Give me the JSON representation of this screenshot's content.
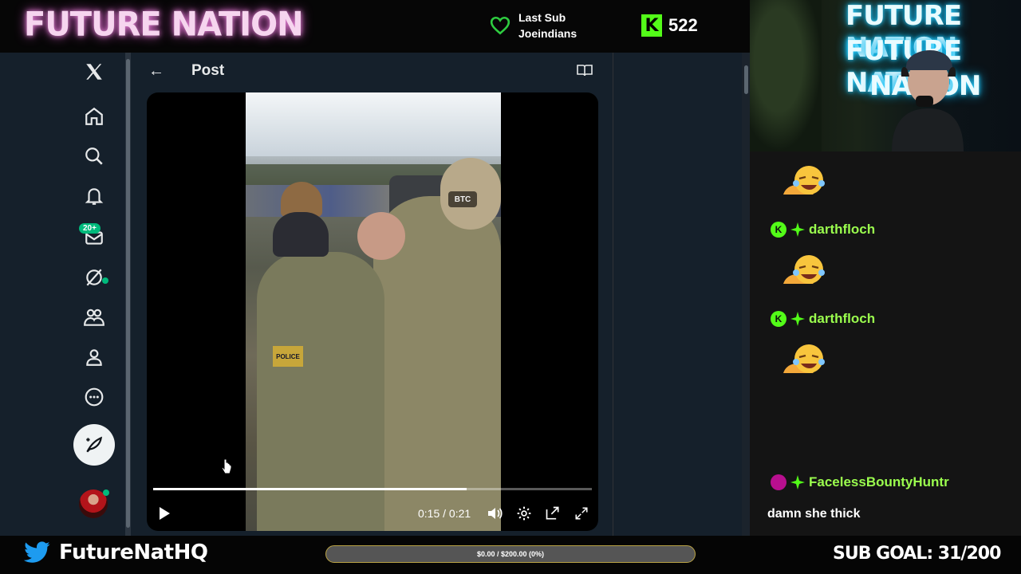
{
  "stream": {
    "brand": "FUTURE NATION",
    "last_sub_label": "Last Sub",
    "last_sub_name": "Joeindians",
    "kick_logo": "K",
    "kick_count": "522",
    "colors": {
      "kick_green": "#53fc18",
      "heart_green": "#2ecc40",
      "twitter_bg": "#15202b",
      "chat_bg": "#141414"
    }
  },
  "twitter": {
    "nav": [
      {
        "name": "x-logo-icon"
      },
      {
        "name": "home-icon"
      },
      {
        "name": "search-icon"
      },
      {
        "name": "notifications-bell-icon"
      },
      {
        "name": "messages-icon",
        "badge": "20+"
      },
      {
        "name": "grok-icon"
      },
      {
        "name": "communities-icon"
      },
      {
        "name": "profile-icon"
      },
      {
        "name": "more-icon"
      }
    ],
    "post_header": {
      "title": "Post",
      "back": "←"
    },
    "video": {
      "time": "0:15 / 0:21",
      "progress": 0.714,
      "patch_left": "POLICE",
      "patch_right": "BTC"
    }
  },
  "cam": {
    "neon_lines": [
      "FUTURE NATION",
      "FUTURE NATION",
      "NATION"
    ]
  },
  "chat": {
    "messages": [
      {
        "type": "emote"
      },
      {
        "user": "darthfloch",
        "badge": "kick",
        "type": "emote"
      },
      {
        "user": "darthfloch",
        "badge": "kick",
        "type": "emote"
      },
      {
        "user": "FacelessBountyHuntr",
        "badge": "sub",
        "text": "damn she thick"
      }
    ]
  },
  "bottom": {
    "handle": "FutureNatHQ",
    "goal_text": "$0.00 / $200.00 (0%)",
    "goal_progress": 0,
    "sub_goal": "SUB GOAL: 31/200"
  }
}
